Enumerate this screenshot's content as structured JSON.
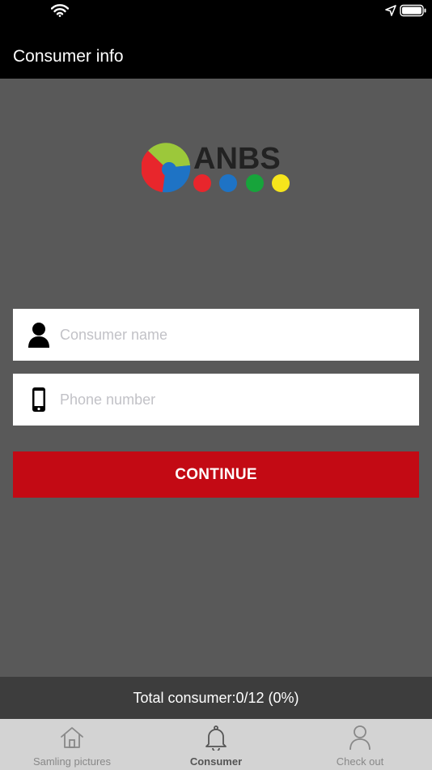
{
  "header": {
    "title": "Consumer info"
  },
  "logo": {
    "text": "ANBS",
    "dot_colors": [
      "#e8262c",
      "#1e73c5",
      "#17a43b",
      "#f6e51c"
    ]
  },
  "form": {
    "name_placeholder": "Consumer name",
    "phone_placeholder": "Phone number",
    "continue_label": "CONTINUE"
  },
  "summary": {
    "text": "Total consumer:0/12 (0%)"
  },
  "tabs": [
    {
      "label": "Samling pictures",
      "icon": "home-icon",
      "active": false
    },
    {
      "label": "Consumer",
      "icon": "bell-icon",
      "active": true
    },
    {
      "label": "Check out",
      "icon": "person-icon",
      "active": false
    }
  ],
  "colors": {
    "accent": "#c30a14",
    "background": "#595959"
  }
}
